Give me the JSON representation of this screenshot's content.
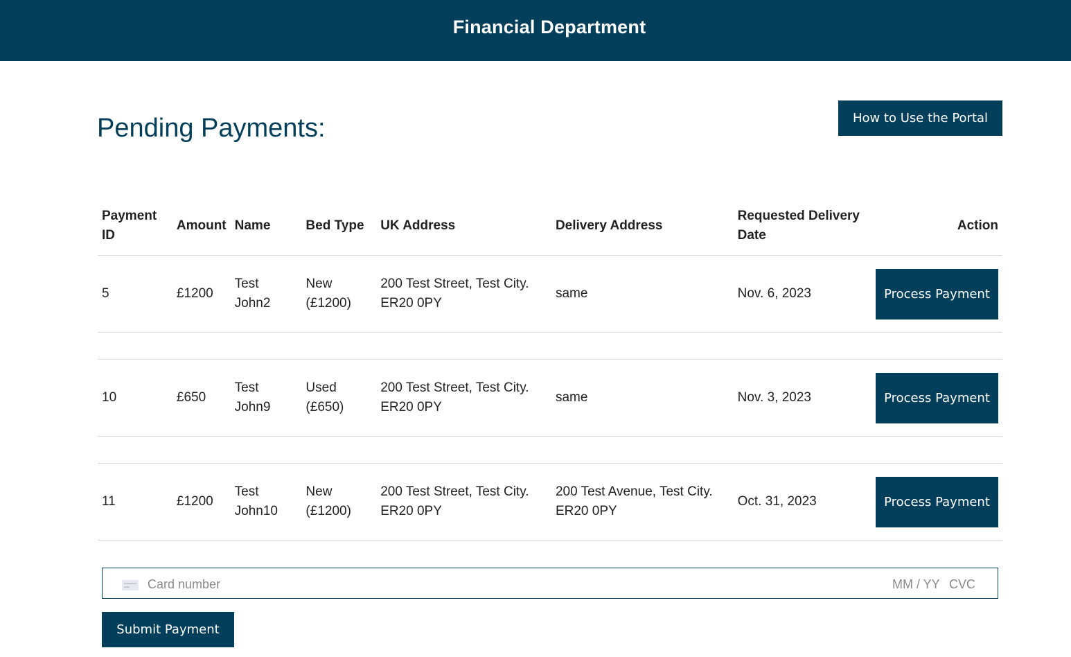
{
  "header": {
    "title": "Financial Department"
  },
  "page": {
    "title": "Pending Payments:"
  },
  "help_button": {
    "label": "How to Use the Portal"
  },
  "table": {
    "columns": {
      "payment_id": "Payment ID",
      "amount": "Amount",
      "name": "Name",
      "bed_type": "Bed Type",
      "uk_address": "UK Address",
      "delivery_address": "Delivery Address",
      "requested_date": "Requested Delivery Date",
      "action": "Action"
    },
    "rows": [
      {
        "id": "5",
        "amount": "£1200",
        "name": "Test John2",
        "bed_type": "New (£1200)",
        "uk_address": "200 Test Street, Test City. ER20 0PY",
        "delivery_address": "same",
        "date": "Nov. 6, 2023",
        "action": "Process Payment"
      },
      {
        "id": "10",
        "amount": "£650",
        "name": "Test John9",
        "bed_type": "Used (£650)",
        "uk_address": "200 Test Street, Test City. ER20 0PY",
        "delivery_address": "same",
        "date": "Nov. 3, 2023",
        "action": "Process Payment"
      },
      {
        "id": "11",
        "amount": "£1200",
        "name": "Test John10",
        "bed_type": "New (£1200)",
        "uk_address": "200 Test Street, Test City. ER20 0PY",
        "delivery_address": "200 Test Avenue, Test City. ER20 0PY",
        "date": "Oct. 31, 2023",
        "action": "Process Payment"
      }
    ]
  },
  "card": {
    "icon": "credit-card-icon",
    "number_placeholder": "Card number",
    "expiry_placeholder": "MM / YY",
    "cvc_placeholder": "CVC"
  },
  "submit_button": {
    "label": "Submit Payment"
  },
  "colors": {
    "brand": "#033f5a",
    "background": "#ffffff"
  }
}
